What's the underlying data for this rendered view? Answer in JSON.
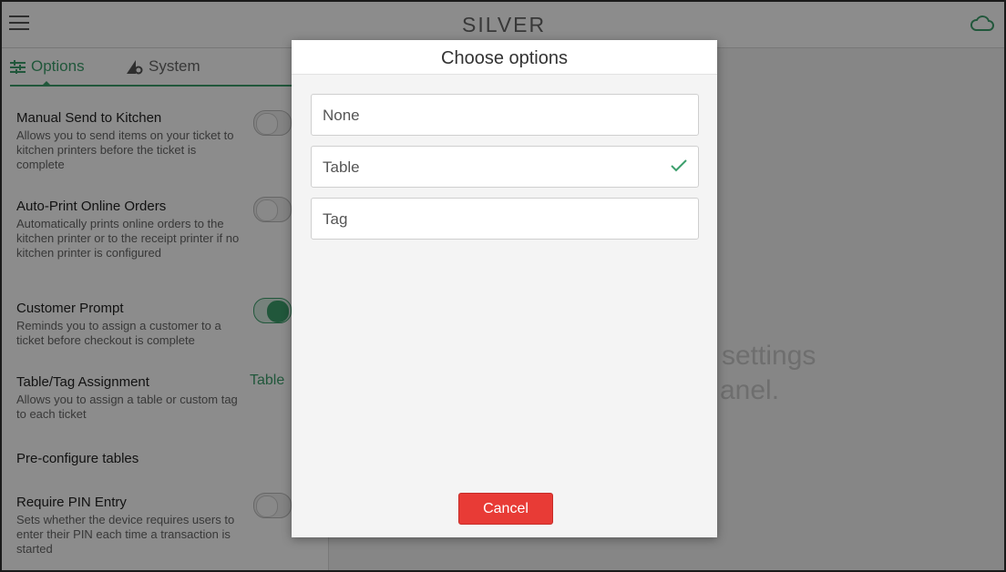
{
  "app": {
    "logo_text": "SILVER"
  },
  "tabs": [
    {
      "label": "Options"
    },
    {
      "label": "System"
    }
  ],
  "settings": [
    {
      "title": "Manual Send to Kitchen",
      "desc": "Allows you to send items on your ticket to kitchen printers before the ticket is complete",
      "toggle": "off"
    },
    {
      "title": "Auto-Print Online Orders",
      "desc": "Automatically prints online orders to the kitchen printer or to the receipt printer if no kitchen printer is configured",
      "toggle": "off"
    },
    {
      "title": "Customer Prompt",
      "desc": "Reminds you to assign a customer to a ticket before checkout is complete",
      "toggle": "on"
    },
    {
      "title": "Table/Tag Assignment",
      "desc": "Allows you to assign a table or custom tag to each ticket",
      "value": "Table"
    },
    {
      "title": "Pre-configure tables"
    },
    {
      "title": "Require PIN Entry",
      "desc": "Sets whether the device requires users to enter their PIN each time a transaction is started",
      "toggle": "off"
    }
  ],
  "right_hint": {
    "line1": "settings",
    "line2": "anel."
  },
  "dialog": {
    "title": "Choose options",
    "options": [
      {
        "label": "None",
        "selected": false
      },
      {
        "label": "Table",
        "selected": true
      },
      {
        "label": "Tag",
        "selected": false
      }
    ],
    "cancel_label": "Cancel"
  },
  "colors": {
    "accent": "#3c9f6c",
    "danger": "#e83b36"
  }
}
